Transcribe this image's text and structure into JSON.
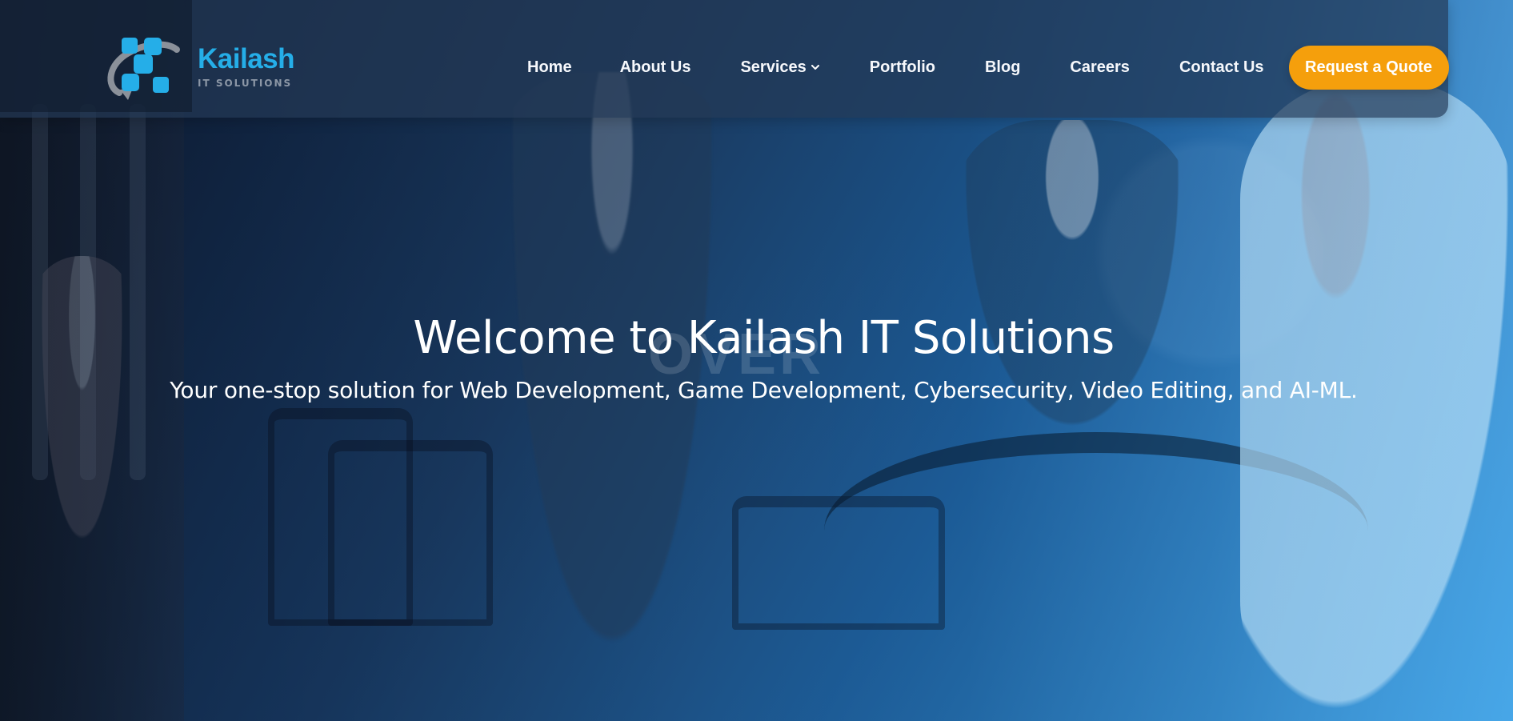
{
  "brand": {
    "name": "Kailash",
    "subtitle": "IT SOLUTIONS",
    "icon": "kailash-logo-icon",
    "colors": {
      "primary": "#25aee8",
      "secondary": "#8c97a6",
      "accent": "#f59f0c"
    }
  },
  "navigation": {
    "items": [
      {
        "label": "Home"
      },
      {
        "label": "About Us"
      },
      {
        "label": "Services",
        "icon": "chevron-down-icon"
      },
      {
        "label": "Portfolio"
      },
      {
        "label": "Blog"
      },
      {
        "label": "Careers"
      },
      {
        "label": "Contact Us"
      }
    ],
    "cta": "Request a Quote"
  },
  "hero": {
    "title": "Welcome to Kailash IT Solutions",
    "subtitle": "Your one-stop solution for Web Development, Game Development, Cybersecurity, Video Editing, and AI-ML.",
    "background_text": "OVER"
  }
}
